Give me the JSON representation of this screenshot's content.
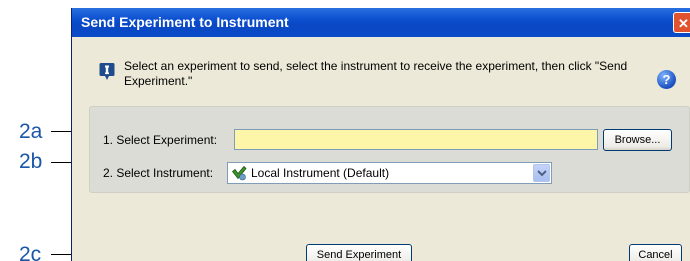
{
  "callouts": {
    "a": "2a",
    "b": "2b",
    "c": "2c"
  },
  "window": {
    "title": "Send Experiment to Instrument",
    "close_glyph": "✕"
  },
  "instruction": "Select an experiment to send, select the instrument to receive the experiment, then click \"Send Experiment.\"",
  "help_glyph": "?",
  "form": {
    "experiment_label": "1. Select Experiment:",
    "experiment_value": "",
    "browse_label": "Browse...",
    "instrument_label": "2. Select Instrument:",
    "instrument_value": "Local Instrument (Default)"
  },
  "actions": {
    "send_label": "Send Experiment",
    "cancel_label": "Cancel"
  },
  "icons": {
    "info": "info-icon",
    "help": "help-icon",
    "instrument": "checkmark-icon",
    "dropdown": "chevron-down-icon"
  },
  "colors": {
    "titlebar": "#0b4fd0",
    "experiment_field": "#fdf6a8",
    "callout_text": "#1a57a8"
  }
}
